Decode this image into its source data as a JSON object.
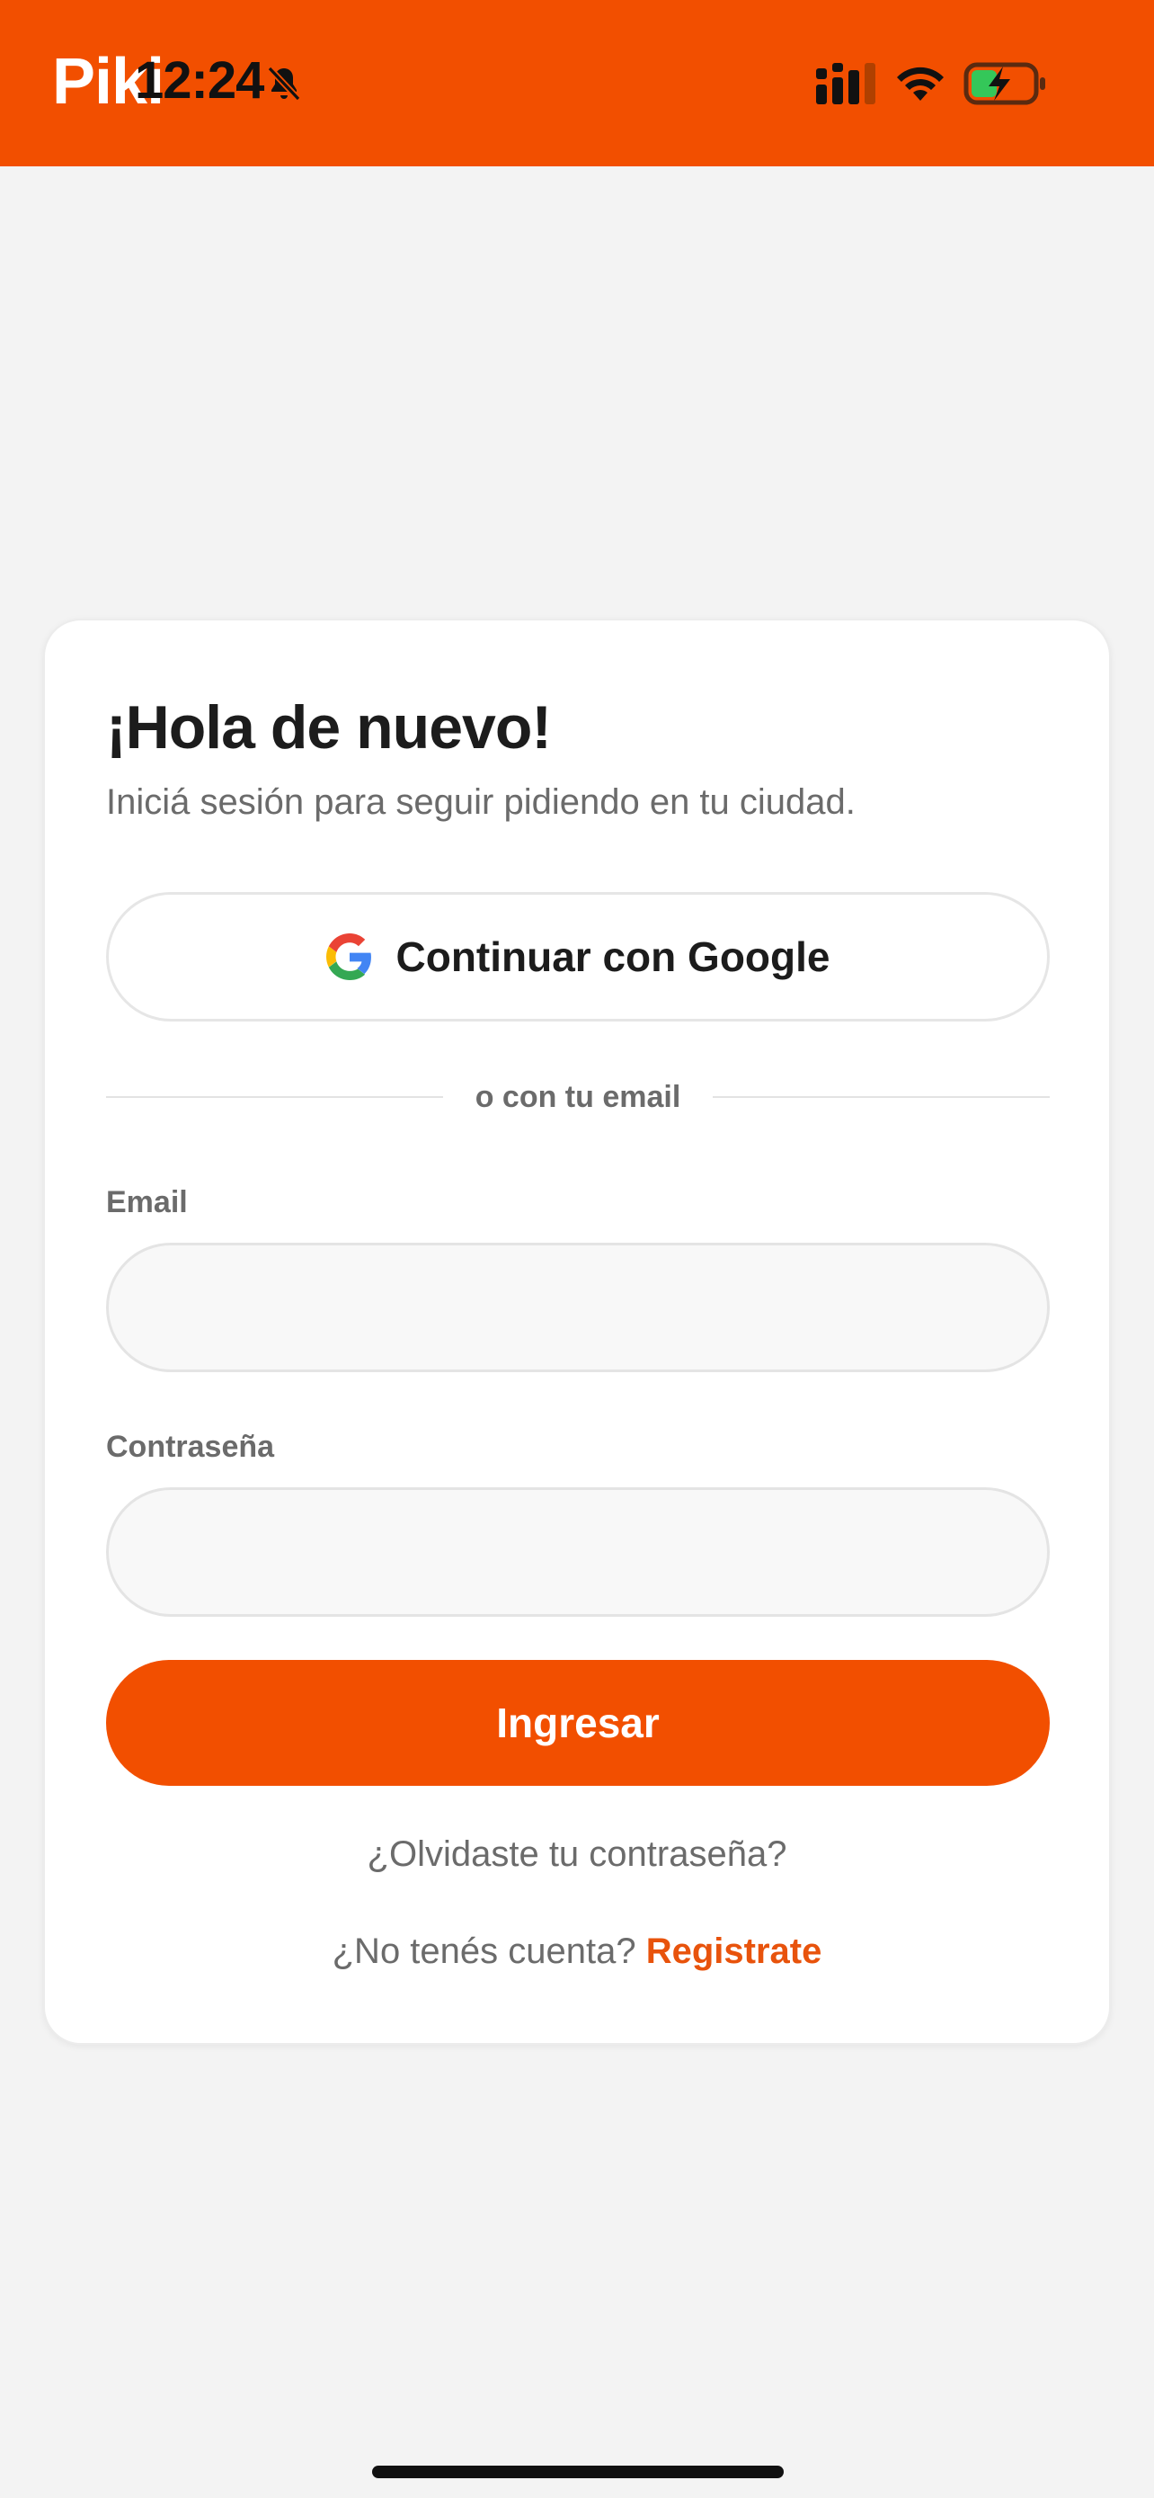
{
  "header": {
    "brand": "Piki",
    "time": "12:24",
    "bg_color": "#f24f00"
  },
  "status_icons": [
    "bell-muted-icon",
    "signal-icon",
    "wifi-icon",
    "battery-charging-icon"
  ],
  "login": {
    "title": "¡Hola de nuevo!",
    "subtitle": "Iniciá sesión para seguir pidiendo en tu ciudad.",
    "google_button_label": "Continuar con Google",
    "divider_label": "o con tu email",
    "email_label": "Email",
    "email_value": "",
    "password_label": "Contraseña",
    "password_value": "",
    "submit_label": "Ingresar",
    "forgot_password_label": "¿Olvidaste tu contraseña?",
    "no_account_label": "¿No tenés cuenta?",
    "register_label": "Registrate"
  },
  "colors": {
    "accent": "#f24f00",
    "link": "#e8530c",
    "text_primary": "#1c1c1c",
    "text_secondary": "#6b6b6b",
    "background": "#f3f3f3"
  }
}
